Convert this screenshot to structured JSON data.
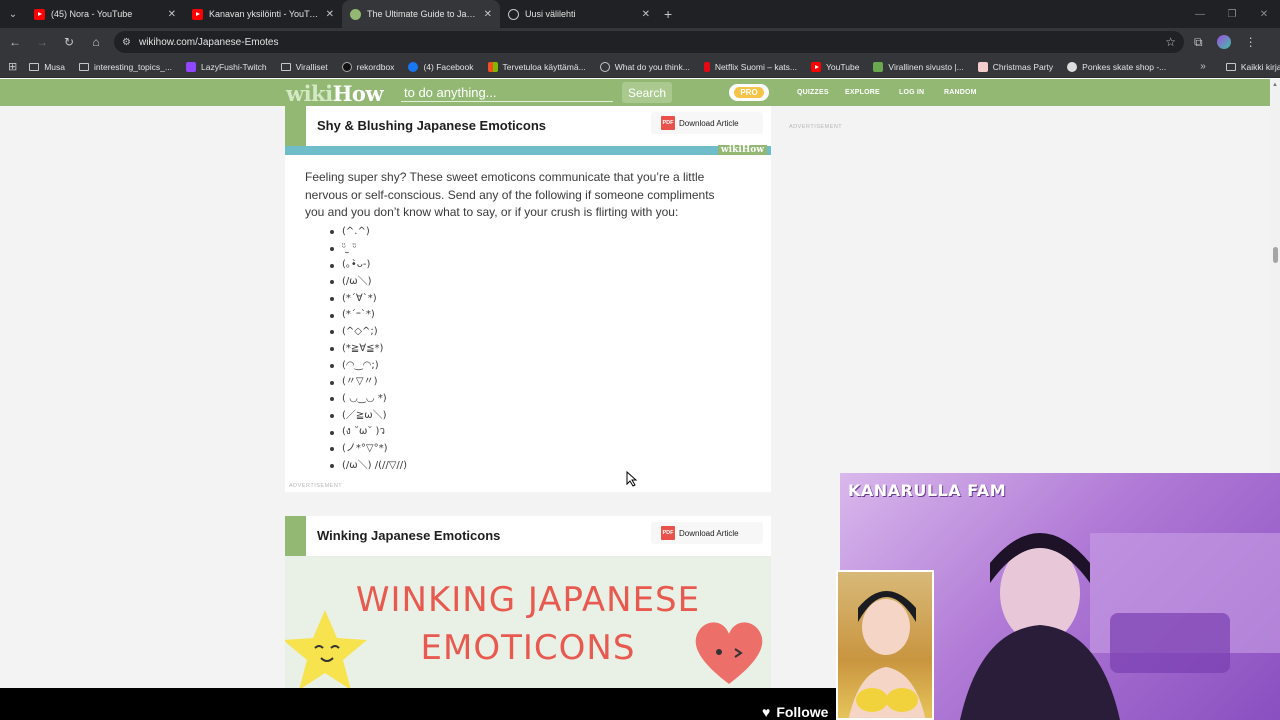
{
  "browser": {
    "tabs": [
      {
        "title": "(45) Nora - YouTube",
        "icon": "youtube-icon",
        "active": false
      },
      {
        "title": "Kanavan yksilöinti - YouTube Stu",
        "icon": "youtube-icon",
        "active": false
      },
      {
        "title": "The Ultimate Guide to Japanese",
        "icon": "wikihow-icon",
        "active": true
      },
      {
        "title": "Uusi välilehti",
        "icon": "globe-icon",
        "active": false
      }
    ],
    "url": "wikihow.com/Japanese-Emotes",
    "bookmarks": [
      {
        "label": "Musa",
        "icon": "folder-icon"
      },
      {
        "label": "interesting_topics_...",
        "icon": "folder-icon"
      },
      {
        "label": "LazyFushi-Twitch",
        "icon": "twitch-icon"
      },
      {
        "label": "Viralliset",
        "icon": "folder-icon"
      },
      {
        "label": "rekordbox",
        "icon": "rekordbox-icon"
      },
      {
        "label": "(4) Facebook",
        "icon": "facebook-icon"
      },
      {
        "label": "Tervetuloa käyttämä...",
        "icon": "microsoft-icon"
      },
      {
        "label": "What do you think...",
        "icon": "globe-icon"
      },
      {
        "label": "Netflix Suomi – kats...",
        "icon": "netflix-icon"
      },
      {
        "label": "YouTube",
        "icon": "youtube-icon"
      },
      {
        "label": "Virallinen sivusto |...",
        "icon": "cube-icon"
      },
      {
        "label": "Christmas Party",
        "icon": "image-icon"
      },
      {
        "label": "Ponkes skate shop -...",
        "icon": "skate-icon"
      }
    ],
    "all_bookmarks": "Kaikki kirjanmerkit"
  },
  "wikihow": {
    "logo_wiki": "wiki",
    "logo_how": "How",
    "search_placeholder": "to do anything...",
    "search_button": "Search",
    "pro": "PRO",
    "nav": [
      "QUIZZES",
      "EXPLORE",
      "LOG IN",
      "RANDOM"
    ],
    "side_ad": "ADVERTISEMENT"
  },
  "section1": {
    "title": "Shy & Blushing Japanese Emoticons",
    "download": "Download Article",
    "pdf": "PDF",
    "watermark": "wikiHow",
    "body": "Feeling super shy? These sweet emoticons communicate that you’re a little nervous or self-conscious. Send any of the following if someone compliments you and you don’t know what to say, or if your crush is flirting with you:",
    "emoticons": [
      "(^.^)",
      "ᵕ̈ ̫ ᵕ̈",
      "(｡•̀ᴗ-)",
      "(/ω＼)",
      "(*´∀`*)",
      "(*´ｰ`*)",
      "(^◇^;)",
      "(*≧∀≦*)",
      "(◠‿◠;)",
      "(〃▽〃)",
      "( ◡‿◡ *)",
      "(／≧ω＼)",
      "(ง ˘ω˘ )ว",
      "(ノ*°▽°*)",
      "(/ω＼) /(//▽//)"
    ],
    "ad_label": "ADVERTISEMENT"
  },
  "section2": {
    "title": "Winking Japanese Emoticons",
    "download": "Download Article",
    "pdf": "PDF",
    "banner_line1": "WINKING JAPANESE",
    "banner_line2": "EMOTICONS"
  },
  "stream": {
    "overlay_title": "KANARULLA FAM",
    "followers": "Followe"
  },
  "colors": {
    "wikihow_green": "#93b874",
    "teal": "#6ebdc9",
    "banner_red": "#e85a4f",
    "chrome_dark": "#202124"
  }
}
